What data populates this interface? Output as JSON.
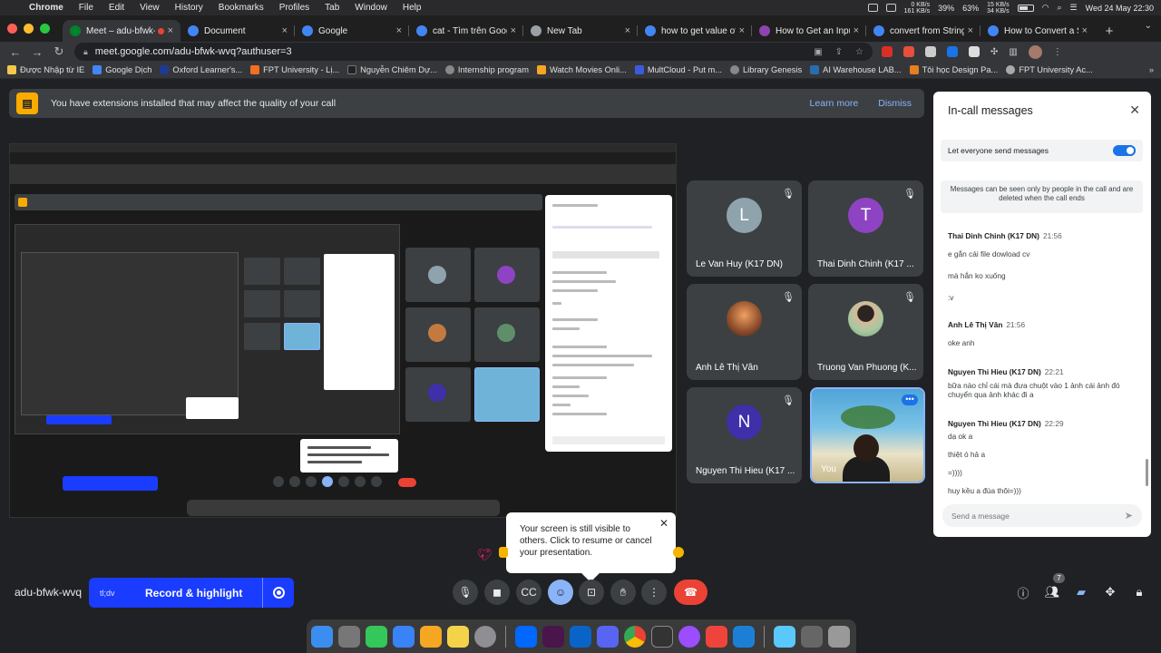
{
  "menubar": {
    "items": [
      "Chrome",
      "File",
      "Edit",
      "View",
      "History",
      "Bookmarks",
      "Profiles",
      "Tab",
      "Window",
      "Help"
    ],
    "net_up": "0 KB/s",
    "net_down": "161 KB/s",
    "cpu": "39%",
    "battery": "63%",
    "net2_up": "15 KB/s",
    "net2_down": "34 KB/s",
    "clock": "Wed 24 May  22:30"
  },
  "tabs": [
    {
      "title": "Meet – adu-bfwk-",
      "color": "#00832d"
    },
    {
      "title": "Document",
      "color": "#4285f4"
    },
    {
      "title": "Google",
      "color": "#4285f4"
    },
    {
      "title": "cat - Tìm trên Google",
      "color": "#4285f4"
    },
    {
      "title": "New Tab",
      "color": "#9aa0a6"
    },
    {
      "title": "how to get value of in",
      "color": "#4285f4"
    },
    {
      "title": "How to Get an Input's",
      "color": "#8e44ad"
    },
    {
      "title": "convert from String to",
      "color": "#4285f4"
    },
    {
      "title": "How to Convert a Stri",
      "color": "#4285f4"
    }
  ],
  "toolbar": {
    "url": "meet.google.com/adu-bfwk-wvq?authuser=3"
  },
  "bookmarks": [
    {
      "label": "Được Nhập từ IE",
      "color": "#f2c94c"
    },
    {
      "label": "Google Dịch",
      "color": "#4285f4"
    },
    {
      "label": "Oxford Learner's...",
      "color": "#1f3a93"
    },
    {
      "label": "FPT University - Lị...",
      "color": "#f36f21"
    },
    {
      "label": "Nguyễn Chiêm Dự...",
      "color": "#222"
    },
    {
      "label": "Internship program",
      "color": "#888"
    },
    {
      "label": "Watch Movies Onli...",
      "color": "#f5a623"
    },
    {
      "label": "MultCloud - Put m...",
      "color": "#3b5bdb"
    },
    {
      "label": "Library Genesis",
      "color": "#888"
    },
    {
      "label": "AI Warehouse LAB...",
      "color": "#2b6cb0"
    },
    {
      "label": "Tôi học Design Pa...",
      "color": "#e67e22"
    },
    {
      "label": "FPT University Ac...",
      "color": "#aaa"
    }
  ],
  "extension_banner": {
    "message": "You have extensions installed that may affect the quality of your call",
    "learn_more": "Learn more",
    "dismiss": "Dismiss"
  },
  "participants": [
    {
      "name": "Le Van Huy (K17 DN)",
      "initial": "L",
      "color": "#8fa3ad",
      "photo": false
    },
    {
      "name": "Thai Dinh Chinh (K17 ...",
      "initial": "T",
      "color": "#8e44c2",
      "photo": false
    },
    {
      "name": "Anh Lê Thị Vân",
      "initial": "",
      "color": "#c47a3e",
      "photo": true
    },
    {
      "name": "Truong Van Phuong (K...",
      "initial": "",
      "color": "#5f8f6a",
      "photo": true
    },
    {
      "name": "Nguyen Thi Hieu (K17 ...",
      "initial": "N",
      "color": "#3f2fa8",
      "photo": false
    },
    {
      "name": "You",
      "initial": "",
      "color": "",
      "photo": true
    }
  ],
  "chat": {
    "title": "In-call messages",
    "toggle_label": "Let everyone send messages",
    "toggle_on": true,
    "note": "Messages can be seen only by people in the call and are deleted when the call ends",
    "groups": [
      {
        "sender": "Thai Dinh Chinh (K17 DN)",
        "time": "21:56",
        "lines": [
          "e gắn cái file dowload cv",
          "mà hắn ko xuống",
          ":v"
        ]
      },
      {
        "sender": "Anh Lê Thị Vân",
        "time": "21:56",
        "lines": [
          "oke anh"
        ]
      },
      {
        "sender": "Nguyen Thi Hieu (K17 DN)",
        "time": "22:21",
        "lines": [
          "bữa nào chỉ cái mà đưa chuột vào 1 ảnh cái ảnh đó chuyển qua ảnh khác đi a"
        ]
      },
      {
        "sender": "Nguyen Thi Hieu (K17 DN)",
        "time": "22:29",
        "lines": [
          "dạ ok a",
          "thiệt ó hả a",
          "=))))",
          "huy kều a đùa thôi=)))"
        ]
      }
    ],
    "input_placeholder": "Send a message"
  },
  "popup": {
    "text": "Your screen is still visible to others. Click to resume or cancel your presentation."
  },
  "controls": {
    "meeting_code": "adu-bfwk-wvq",
    "record_logo": "tl;dv",
    "record_label": "Record & highlight",
    "people_count": "7"
  },
  "dock_apps": [
    {
      "name": "finder",
      "color": "#3b8ef0"
    },
    {
      "name": "launchpad",
      "color": "#777"
    },
    {
      "name": "messages",
      "color": "#34c759"
    },
    {
      "name": "mail",
      "color": "#3a82f7"
    },
    {
      "name": "photos",
      "color": "#f5a623"
    },
    {
      "name": "notes",
      "color": "#f4d34a"
    },
    {
      "name": "settings",
      "color": "#8e8e93"
    },
    {
      "name": "zalo",
      "color": "#0068ff"
    },
    {
      "name": "slack",
      "color": "#4a154b"
    },
    {
      "name": "outlook",
      "color": "#0a64c8"
    },
    {
      "name": "discord",
      "color": "#5865f2"
    },
    {
      "name": "chrome",
      "color": "#e8eaed"
    },
    {
      "name": "activity",
      "color": "#333"
    },
    {
      "name": "messenger",
      "color": "#9b4dff"
    },
    {
      "name": "anydesk",
      "color": "#ef443b"
    },
    {
      "name": "vscode",
      "color": "#1c7fd6"
    },
    {
      "name": "folder",
      "color": "#5ac8fa"
    },
    {
      "name": "preview",
      "color": "#666"
    },
    {
      "name": "trash",
      "color": "#999"
    }
  ]
}
